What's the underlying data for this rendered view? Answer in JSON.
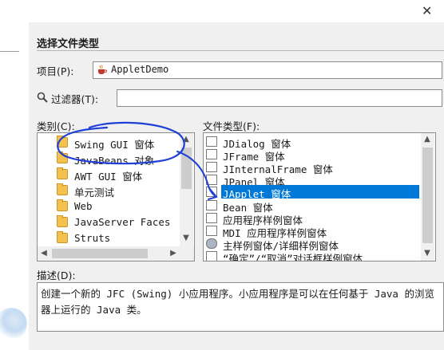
{
  "window": {
    "close_glyph": "✕"
  },
  "dialog": {
    "title": "选择文件类型",
    "project": {
      "label": "项目(P):",
      "value": "AppletDemo",
      "icon": "java-cup-icon"
    },
    "filter": {
      "label": "过滤器(T):",
      "value": ""
    },
    "categories": {
      "label": "类别(C):",
      "items": [
        {
          "label": "Swing GUI 窗体"
        },
        {
          "label": "JavaBeans 对象"
        },
        {
          "label": "AWT GUI 窗体"
        },
        {
          "label": "单元测试"
        },
        {
          "label": "Web"
        },
        {
          "label": "JavaServer Faces"
        },
        {
          "label": "Struts"
        }
      ]
    },
    "file_types": {
      "label": "文件类型(F):",
      "items": [
        {
          "label": "JDialog 窗体"
        },
        {
          "label": "JFrame 窗体"
        },
        {
          "label": "JInternalFrame 窗体"
        },
        {
          "label": "JPanel 窗体"
        },
        {
          "label": "JApplet 窗体",
          "selected": true
        },
        {
          "label": "Bean 窗体"
        },
        {
          "label": "应用程序样例窗体"
        },
        {
          "label": "MDI 应用程序样例窗体"
        },
        {
          "label": "主样例窗体/详细样例窗体"
        },
        {
          "label": "“确定”/“取消”对话框样例窗体"
        }
      ]
    },
    "description": {
      "label": "描述(D):",
      "text": "创建一个新的 JFC (Swing) 小应用程序。小应用程序是可以在任何基于 Java 的浏览器上运行的 Java 类。"
    }
  },
  "colors": {
    "selection": "#0078d7",
    "annotation": "#1f3fd6"
  }
}
